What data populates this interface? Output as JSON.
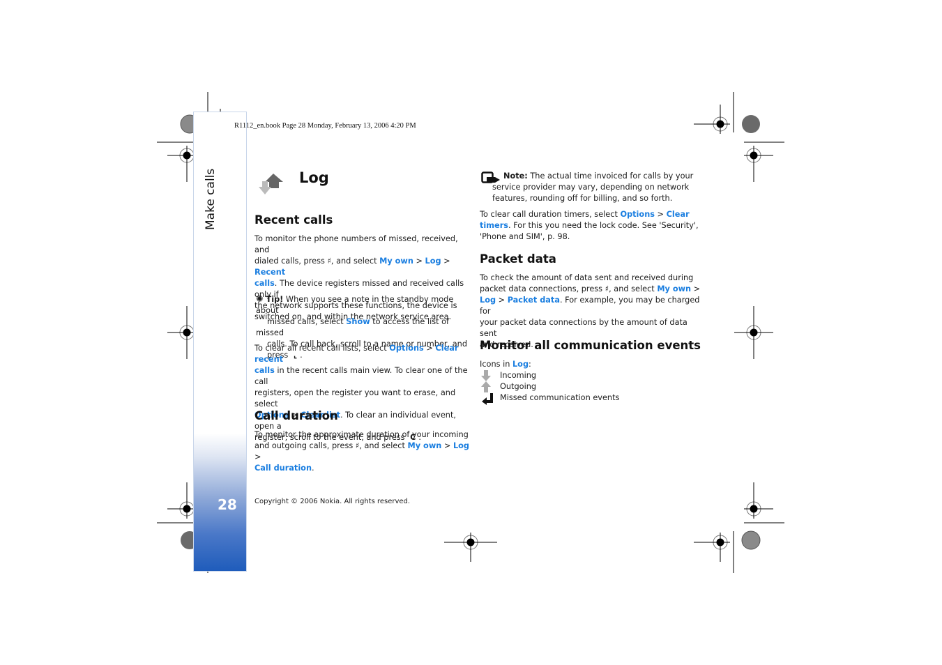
{
  "header_line": "R1112_en.book  Page 28  Monday, February 13, 2006  4:20 PM",
  "sidebar": {
    "section_title": "Make calls",
    "page_number": "28"
  },
  "page_title": "Log",
  "icons": {
    "log": "log-icon",
    "tip": "tip-lightbulb-icon",
    "note": "note-icon",
    "menu_key": "menu-key-icon",
    "call_key": "call-key-icon",
    "clear_key": "clear-key-icon",
    "incoming": "arrow-down-icon",
    "outgoing": "arrow-up-icon",
    "missed": "missed-arrow-icon"
  },
  "colors": {
    "link": "#1a7ee0",
    "sidebar_blue": "#1f5cbb"
  },
  "recent_calls": {
    "heading": "Recent calls",
    "p1": {
      "t1": "To monitor the phone numbers of missed, received, and",
      "t2": "dialed calls, press ",
      "t3": ", and select ",
      "l1": "My own",
      "gt1": " > ",
      "l2": "Log",
      "gt2": " > ",
      "l3": "Recent",
      "l3b": "calls",
      "t4": ". The device registers missed and received calls only if",
      "t5": "the network supports these functions, the device is",
      "t6": "switched on, and within the network service area."
    },
    "tip": {
      "label": "Tip!",
      "t1": " When you see a note in the standby mode about",
      "t2": "missed calls, select ",
      "l1": "Show",
      "t3": " to access the list of missed",
      "t4": "calls. To call back, scroll to a name or number, and",
      "t5": "press ",
      "t6": "."
    },
    "p2": {
      "t1": "To clear all recent call lists, select ",
      "l1": "Options",
      "gt": " > ",
      "l2": "Clear recent",
      "l2b": "calls",
      "t2": " in the recent calls main view. To clear one of the call",
      "t3": "registers, open the register you want to erase, and select",
      "l3": "Options",
      "gt2": " > ",
      "l4": "Clear list",
      "t4": ". To clear an individual event, open a",
      "t5": "register, scroll to the event, and press ",
      "t6": "."
    }
  },
  "call_duration": {
    "heading": "Call duration",
    "t1": "To monitor the approximate duration of your incoming",
    "t2": "and outgoing calls, press ",
    "t3": ", and select ",
    "l1": "My own",
    "gt": " > ",
    "l2": "Log",
    "gt2": " >",
    "l3": "Call duration",
    "t4": "."
  },
  "note": {
    "label": "Note:",
    "t1": " The actual time invoiced for calls by your",
    "t2": "service provider may vary, depending on network",
    "t3": "features, rounding off for billing, and so forth."
  },
  "clear_timers": {
    "t1": "To clear call duration timers, select ",
    "l1": "Options",
    "gt": " > ",
    "l2": "Clear",
    "l2b": "timers",
    "t2": ". For this you need the lock code. See 'Security',",
    "t3": "'Phone and SIM', p. 98."
  },
  "packet_data": {
    "heading": "Packet data",
    "t1": "To check the amount of data sent and received during",
    "t2": "packet data connections, press ",
    "t3": ", and select ",
    "l1": "My own",
    "gt": " >",
    "l2": "Log",
    "gt2": " > ",
    "l3": "Packet data",
    "t4": ". For example, you may be charged for",
    "t5": "your packet data connections by the amount of data sent",
    "t6": "and received."
  },
  "monitor": {
    "heading": "Monitor all communication events",
    "intro": "Icons in ",
    "intro_link": "Log",
    "intro_end": ":",
    "items": [
      {
        "label": "Incoming"
      },
      {
        "label": "Outgoing"
      },
      {
        "label": "Missed communication events"
      }
    ]
  },
  "copyright": "Copyright © 2006 Nokia. All rights reserved."
}
